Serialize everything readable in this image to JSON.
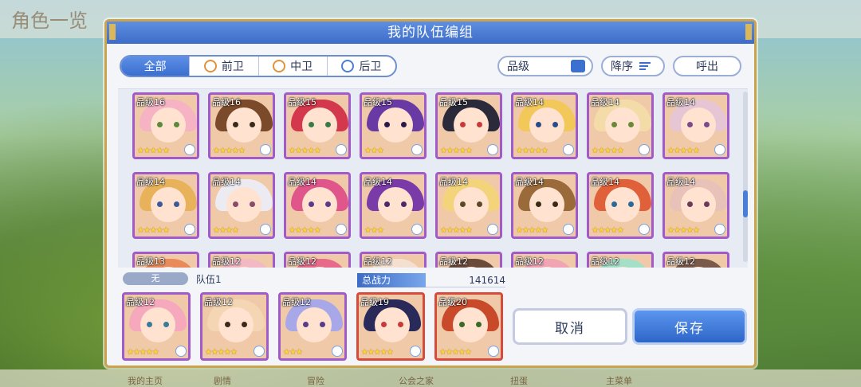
{
  "background": {
    "title": "角色一览",
    "nav": [
      "我的主页",
      "剧情",
      "冒险",
      "公会之家",
      "扭蛋",
      "主菜单"
    ]
  },
  "dialog": {
    "title": "我的队伍编组",
    "filter_tabs": [
      {
        "label": "全部",
        "active": true
      },
      {
        "label": "前卫",
        "icon": "front-icon"
      },
      {
        "label": "中卫",
        "icon": "middle-icon"
      },
      {
        "label": "后卫",
        "icon": "back-icon"
      }
    ],
    "sort_by_label": "品级",
    "order_label": "降序",
    "call_label": "呼出"
  },
  "roster": {
    "rows": [
      [
        {
          "level": "品级16",
          "stars": "★★★★★",
          "hair": "#f6b3c4",
          "eye": "#5a8a3a"
        },
        {
          "level": "品级16",
          "stars": "★★★★★",
          "hair": "#7a4a2a",
          "eye": "#3a2a1a"
        },
        {
          "level": "品级15",
          "stars": "★★★★★",
          "hair": "#d4384c",
          "eye": "#3a7a4a"
        },
        {
          "level": "品级15",
          "stars": "★★★",
          "hair": "#6a3aa4",
          "eye": "#2a1a4a"
        },
        {
          "level": "品级15",
          "stars": "★★★★★",
          "hair": "#2a2a3a",
          "eye": "#c83a3a"
        },
        {
          "level": "品级14",
          "stars": "★★★★★",
          "hair": "#f2c85a",
          "eye": "#2a4a8a"
        },
        {
          "level": "品级14",
          "stars": "★★★★★",
          "hair": "#f4dca8",
          "eye": "#6a8a3a"
        },
        {
          "level": "品级14",
          "stars": "★★★★★",
          "hair": "#e6c6d4",
          "eye": "#7a4a8a"
        }
      ],
      [
        {
          "level": "品级14",
          "stars": "★★★★★",
          "hair": "#e8b25a",
          "eye": "#3a5a9a"
        },
        {
          "level": "品级14",
          "stars": "★★★★",
          "hair": "#ecebf2",
          "eye": "#8a4a6a"
        },
        {
          "level": "品级14",
          "stars": "★★★★★",
          "hair": "#e0558a",
          "eye": "#5a3a8a"
        },
        {
          "level": "品级14",
          "stars": "★★★",
          "hair": "#7a3aa8",
          "eye": "#4a2a6a"
        },
        {
          "level": "品级14",
          "stars": "★★★★★",
          "hair": "#f4d47a",
          "eye": "#5a4a2a"
        },
        {
          "level": "品级14",
          "stars": "★★★★★",
          "hair": "#9a6a3a",
          "eye": "#3a2a1a"
        },
        {
          "level": "品级14",
          "stars": "★★★★★",
          "hair": "#e0603a",
          "eye": "#2a6a9a"
        },
        {
          "level": "品级14",
          "stars": "★★★★★",
          "hair": "#e8c2b8",
          "eye": "#6a3a5a"
        }
      ],
      [
        {
          "level": "品级13",
          "stars": "",
          "hair": "#e88a5a",
          "eye": "#3a2a1a"
        },
        {
          "level": "品级12",
          "stars": "",
          "hair": "#f2b8c4",
          "eye": "#3a2a1a"
        },
        {
          "level": "品级12",
          "stars": "",
          "hair": "#e86a8a",
          "eye": "#3a2a1a"
        },
        {
          "level": "品级12",
          "stars": "",
          "hair": "#f4e0d0",
          "eye": "#3a2a1a"
        },
        {
          "level": "品级12",
          "stars": "",
          "hair": "#6a4a3a",
          "eye": "#3a2a1a"
        },
        {
          "level": "品级12",
          "stars": "",
          "hair": "#f0a4b4",
          "eye": "#3a2a1a"
        },
        {
          "level": "品级12",
          "stars": "",
          "hair": "#a4e0c8",
          "eye": "#3a2a1a"
        },
        {
          "level": "品级12",
          "stars": "",
          "hair": "#7a5a4a",
          "eye": "#3a2a1a"
        }
      ]
    ]
  },
  "team": {
    "label_none": "无",
    "name": "队伍1",
    "power_label": "总战力",
    "power_value": "141614",
    "members": [
      {
        "level": "品级12",
        "stars": "★★★★★",
        "hair": "#f6a8bc",
        "eye": "#3a7a9a",
        "border": "purple"
      },
      {
        "level": "品级12",
        "stars": "★★★★★",
        "hair": "#f4d6b4",
        "eye": "#3a2a1a",
        "border": "purple"
      },
      {
        "level": "品级12",
        "stars": "★★★",
        "hair": "#a8a8e8",
        "eye": "#5a3a8a",
        "border": "purple"
      },
      {
        "level": "品级19",
        "stars": "★★★★★",
        "hair": "#2a2a5a",
        "eye": "#c83a3a",
        "border": "red"
      },
      {
        "level": "品级20",
        "stars": "★★★★★",
        "hair": "#c84a2a",
        "eye": "#3a6a2a",
        "border": "red"
      }
    ]
  },
  "actions": {
    "cancel_label": "取消",
    "save_label": "保存"
  },
  "colors": {
    "header_blue": "#3c6cc8",
    "gold_frame": "#c9a44c",
    "card_purple": "#a15ac9",
    "card_red": "#d84a3a"
  }
}
